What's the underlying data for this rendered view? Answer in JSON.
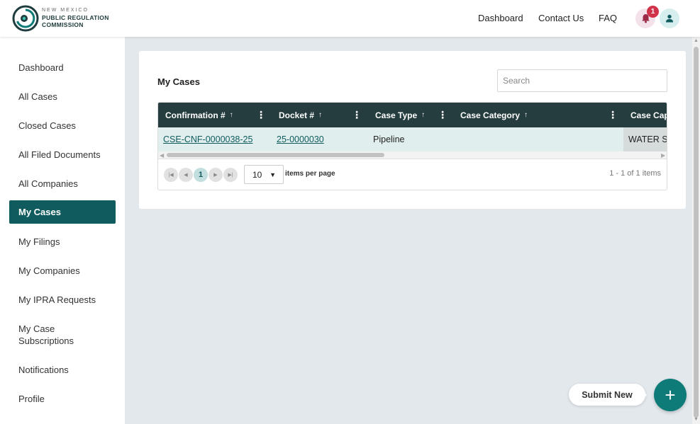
{
  "header": {
    "logo": {
      "line1": "NEW MEXICO",
      "line2": "PUBLIC REGULATION",
      "line3": "COMMISSION"
    },
    "nav": [
      "Dashboard",
      "Contact Us",
      "FAQ"
    ],
    "notification_count": "1",
    "icons": {
      "notifications": "bell-icon",
      "user": "user-icon"
    }
  },
  "sidebar": {
    "items": [
      "Dashboard",
      "All Cases",
      "Closed Cases",
      "All Filed Documents",
      "All Companies",
      "My Cases",
      "My Filings",
      "My Companies",
      "My IPRA Requests",
      "My Case Subscriptions",
      "Notifications",
      "Profile"
    ],
    "active": "My Cases"
  },
  "card": {
    "title": "My Cases",
    "search_placeholder": "Search"
  },
  "table": {
    "columns": [
      "Confirmation #",
      "Docket #",
      "Case Type",
      "Case Category",
      "Case Capt"
    ],
    "rows": [
      {
        "confirmation": "CSE-CNF-0000038-25",
        "docket": "25-0000030",
        "case_type": "Pipeline",
        "case_category": "",
        "caption": "WATER SU"
      }
    ]
  },
  "pager": {
    "current_page": "1",
    "page_size": "10",
    "items_per_page_label": "items per page",
    "info": "1 - 1 of 1 items"
  },
  "actions": {
    "submit_new": "Submit New",
    "fab_symbol": "+"
  },
  "colors": {
    "primary": "#0f5b5e",
    "header_dark": "#263d3f",
    "accent_red": "#d1334a",
    "fab": "#0f7b78"
  }
}
